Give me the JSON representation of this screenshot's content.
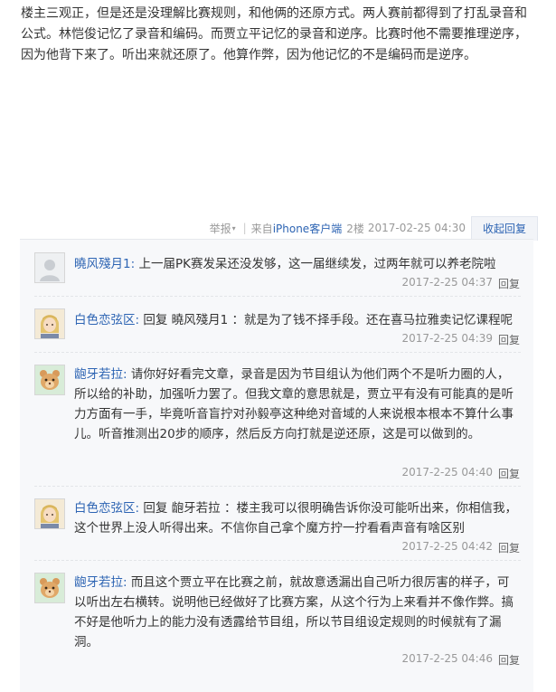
{
  "post": {
    "body": "楼主三观正，但是还是没理解比赛规则，和他俩的还原方式。两人赛前都得到了打乱录音和公式。林恺俊记忆了录音和编码。而贾立平记忆的录音和逆序。比赛时他不需要推理逆序，因为他背下来了。听出来就还原了。他算作弊，因为他记忆的不是编码而是逆序。"
  },
  "tail": {
    "report_label": "举报",
    "report_caret": "▾",
    "separator": "|",
    "client_prefix": "来自",
    "client_name": "iPhone客户端",
    "floor": "2楼",
    "time": "2017-02-25 04:30",
    "collapse_label": "收起回复"
  },
  "replies": [
    {
      "user": "曉风殘月1",
      "colon": ":",
      "text": "上一届PK赛发呆还没发够，这一届继续发，过两年就可以养老院啦",
      "time": "2017-2-25 04:37",
      "reply_label": "回复",
      "avatar_icon": "default-avatar-icon"
    },
    {
      "user": "白色恋弦区",
      "colon": ":",
      "text": "回复 曉风殘月1 ：就是为了钱不择手段。还在喜马拉雅卖记忆课程呢",
      "time": "2017-2-25 04:39",
      "reply_label": "回复",
      "avatar_icon": "blonde-avatar-icon"
    },
    {
      "user": "龅牙若拉",
      "colon": ":",
      "text": "请你好好看完文章，录音是因为节目组认为他们两个不是听力圈的人，所以给的补助，加强听力罢了。但我文章的意思就是，贾立平有没有可能真的是听力方面有一手，毕竟听音盲拧对孙毅亭这种绝对音域的人来说根本根本不算什么事儿。听音推测出20步的顺序，然后反方向打就是逆还原，这是可以做到的。",
      "time": "2017-2-25 04:40",
      "reply_label": "回复",
      "avatar_icon": "cartoon-animal-avatar-icon"
    },
    {
      "user": "白色恋弦区",
      "colon": ":",
      "text": "回复 龅牙若拉 ：楼主我可以很明确告诉你没可能听出来，你相信我，这个世界上没人听得出来。不信你自己拿个魔方拧一拧看看声音有啥区别",
      "time": "2017-2-25 04:42",
      "reply_label": "回复",
      "avatar_icon": "blonde-avatar-icon"
    },
    {
      "user": "龅牙若拉",
      "colon": ":",
      "text": "而且这个贾立平在比赛之前，就故意透漏出自己听力很厉害的样子，可以听出左右横转。说明他已经做好了比赛方案，从这个行为上来看并不像作弊。搞不好是他听力上的能力没有透露给节目组，所以节目组设定规则的时候就有了漏洞。",
      "time": "2017-2-25 04:46",
      "reply_label": "回复",
      "avatar_icon": "cartoon-animal-avatar-icon"
    }
  ]
}
